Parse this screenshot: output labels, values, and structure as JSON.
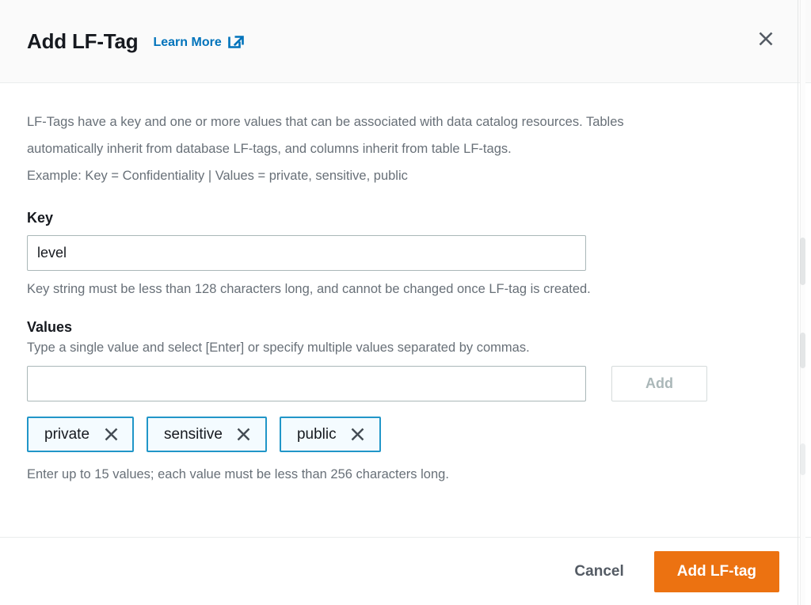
{
  "header": {
    "title": "Add LF-Tag",
    "learn_more_label": "Learn More",
    "external_link_icon": "external-link-icon",
    "close_icon": "close-icon"
  },
  "body": {
    "description_line1": "LF-Tags have a key and one or more values that can be associated with data catalog resources. Tables",
    "description_line2": "automatically inherit from database LF-tags, and columns inherit from table LF-tags.",
    "description_line3": "Example: Key = Confidentiality | Values = private, sensitive, public",
    "key_field": {
      "label": "Key",
      "value": "level",
      "placeholder": "",
      "helper": "Key string must be less than 128 characters long, and cannot be changed once LF-tag is created."
    },
    "values_field": {
      "label": "Values",
      "sub_label": "Type a single value and select [Enter] or specify multiple values separated by commas.",
      "value": "",
      "placeholder": "",
      "add_button_label": "Add",
      "helper": "Enter up to 15 values; each value must be less than 256 characters long.",
      "chips": [
        {
          "label": "private",
          "remove_icon": "close-icon"
        },
        {
          "label": "sensitive",
          "remove_icon": "close-icon"
        },
        {
          "label": "public",
          "remove_icon": "close-icon"
        }
      ]
    }
  },
  "footer": {
    "cancel_label": "Cancel",
    "submit_label": "Add LF-tag"
  },
  "colors": {
    "accent_orange": "#ec7211",
    "link_blue": "#0073bb",
    "chip_border": "#2196c8",
    "chip_background": "#f4fbff",
    "text_primary": "#16191f",
    "text_secondary": "#687078",
    "header_background": "#fafafa",
    "input_border": "#aab7b8"
  }
}
